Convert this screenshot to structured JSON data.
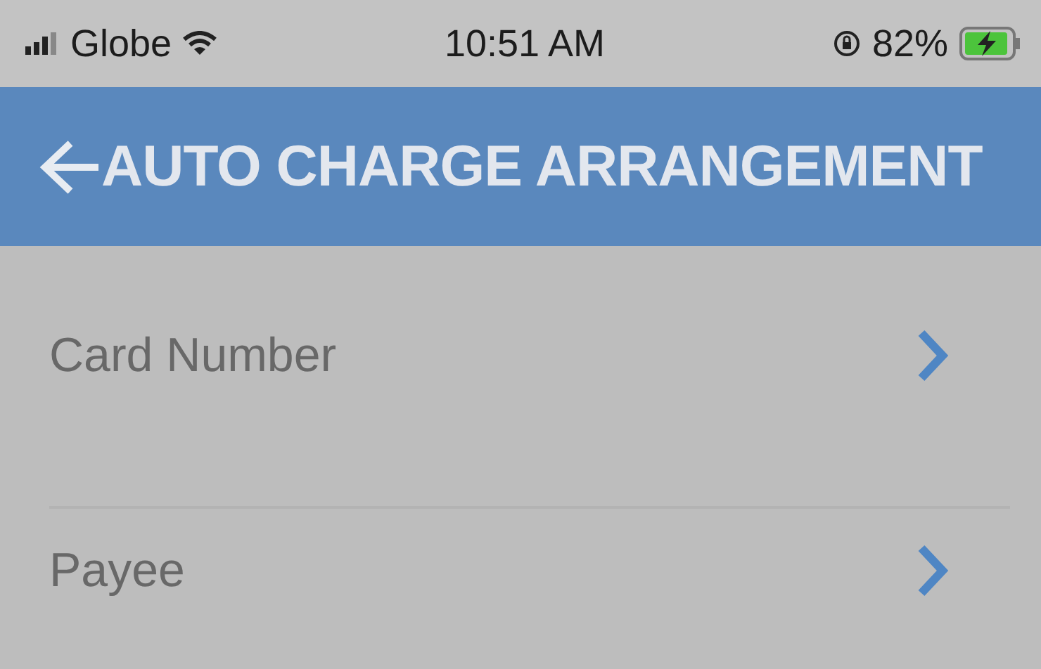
{
  "status_bar": {
    "carrier": "Globe",
    "time": "10:51 AM",
    "battery": "82%"
  },
  "header": {
    "title": "AUTO CHARGE ARRANGEMENT"
  },
  "rows": [
    {
      "label": "Card Number"
    },
    {
      "label": "Payee"
    }
  ]
}
